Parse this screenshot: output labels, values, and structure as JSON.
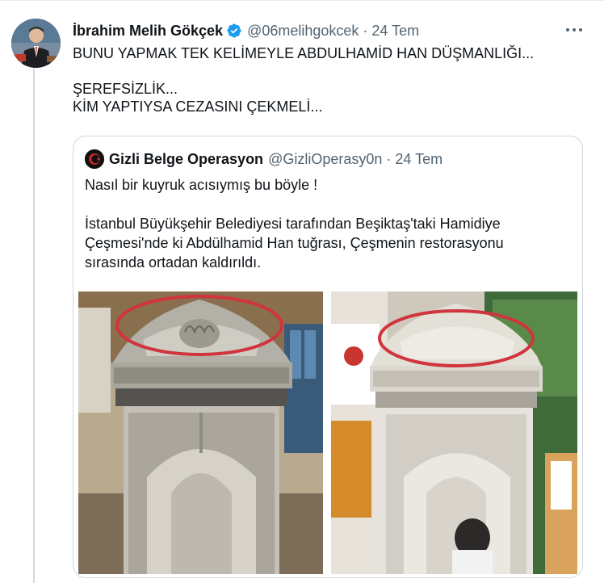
{
  "tweet": {
    "author_name": "İbrahim Melih Gökçek",
    "author_handle": "@06melihgokcek",
    "separator": "·",
    "date": "24 Tem",
    "lines": [
      "BUNU YAPMAK TEK KELİMEYLE ABDULHAMİD HAN DÜŞMANLIĞI...",
      "ŞEREFSİZLİK...",
      "KİM YAPTIYSA CEZASINI ÇEKMELİ..."
    ],
    "verified_icon": "verified-badge-icon",
    "more_icon": "more-dots-icon"
  },
  "quoted": {
    "author_name": "Gizli Belge Operasyon",
    "author_handle": "@GizliOperasy0n",
    "separator": "·",
    "date": "24 Tem",
    "line1": "Nasıl bir kuyruk acısıymış bu böyle !",
    "line2": "İstanbul Büyükşehir Belediyesi tarafından Beşiktaş'taki Hamidiye",
    "line3": "Çeşmesi'nde ki Abdülhamid Han tuğrası, Çeşmenin restorasyonu",
    "line4": "sırasında ortadan kaldırıldı."
  },
  "colors": {
    "text": "#0f1419",
    "secondary": "#536471",
    "border": "#cfd9de",
    "verified": "#1d9bf0",
    "highlight_circle": "#d0343c"
  }
}
